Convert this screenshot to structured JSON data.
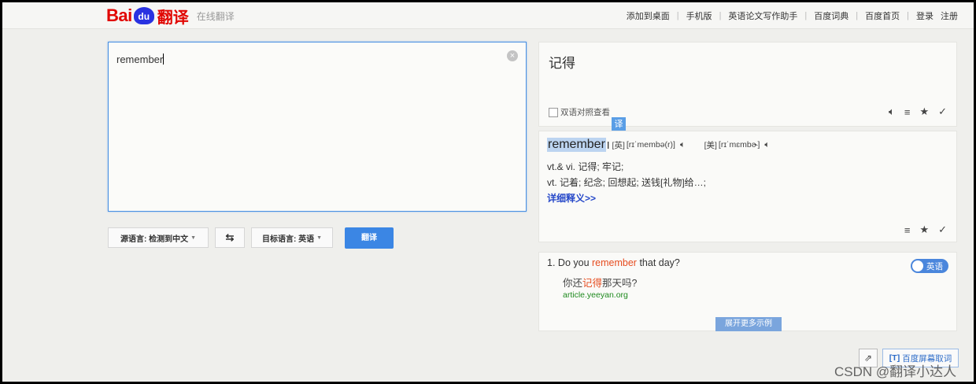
{
  "header": {
    "logo": {
      "bai": "Bai",
      "du": "du",
      "fanyi": "翻译"
    },
    "subtitle": "在线翻译",
    "links": [
      "添加到桌面",
      "手机版",
      "英语论文写作助手",
      "百度词典",
      "百度首页"
    ],
    "login": "登录",
    "register": "注册"
  },
  "input": {
    "value": "remember",
    "clear_icon": "×"
  },
  "controls": {
    "source_lang": "源语言: 检测到中文",
    "swap_icon": "⇆",
    "target_lang": "目标语言: 英语",
    "dropdown_arrow": "▼",
    "translate_label": "翻译"
  },
  "result": {
    "text": "记得",
    "bilingual_label": "双语对照查看",
    "tool_icons": {
      "speaker": "🔈︎",
      "list": "≡",
      "star": "★",
      "check": "✓"
    }
  },
  "tooltip": {
    "label": "译"
  },
  "dictionary": {
    "word": "remember",
    "uk_label": "[英]",
    "uk_phonetic": "[rɪˈmembə(r)]",
    "us_label": "[美]",
    "us_phonetic": "[rɪˈmɛmbɚ]",
    "definitions": [
      "vt.& vi. 记得; 牢记;",
      "vt. 记着; 纪念; 回想起; 送钱[礼物]给…;"
    ],
    "more_link": "详细释义>>"
  },
  "examples": {
    "number": "1.",
    "en_before": "Do you ",
    "en_highlight": "remember",
    "en_after": " that day?",
    "zh_before": "你还",
    "zh_highlight": "记得",
    "zh_after": "那天吗?",
    "source": "article.yeeyan.org",
    "toggle_label": "英语",
    "expand_label": "展开更多示例"
  },
  "footer": {
    "share_icon": "⇗",
    "screen_word_icon": "[T]",
    "screen_word_label": "百度屏幕取词",
    "watermark": "CSDN @翻译小达人"
  },
  "colors": {
    "brand_red": "#e10602",
    "brand_blue": "#2932e1",
    "accent_blue": "#3b86e4",
    "highlight": "#e64c1f",
    "source_green": "#1f8a1f"
  }
}
